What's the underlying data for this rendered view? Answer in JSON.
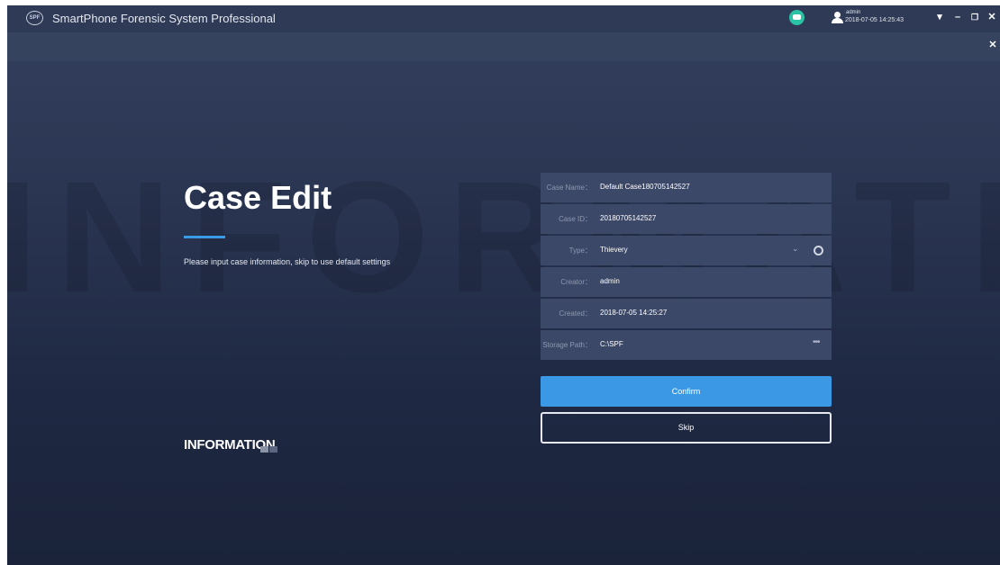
{
  "titlebar": {
    "logo_text": "SPF",
    "app_title": "SmartPhone Forensic System Professional",
    "user": {
      "name": "admin",
      "time": "2018-07-05 14:25:43"
    },
    "controls": {
      "menu": "▾",
      "minimize": "–",
      "restore": "❐",
      "close": "✕"
    }
  },
  "panel_close": "✕",
  "watermark": "INFORMATION",
  "page": {
    "title": "Case Edit",
    "description": "Please input case information, skip to use default settings",
    "info_label": "INFORMATION",
    "accent_color": "#3a9ae6"
  },
  "form": {
    "case_name": {
      "label": "Case Name：",
      "value": "Default Case180705142527"
    },
    "case_id": {
      "label": "Case ID：",
      "value": "20180705142527"
    },
    "type": {
      "label": "Type：",
      "value": "Thievery",
      "chevron": "⌄"
    },
    "creator": {
      "label": "Creator：",
      "value": "admin"
    },
    "created": {
      "label": "Created：",
      "value": "2018-07-05 14:25:27"
    },
    "storage_path": {
      "label": "Storage Path：",
      "value": "C:\\SPF",
      "more": "•••"
    }
  },
  "buttons": {
    "confirm": "Confirm",
    "skip": "Skip"
  },
  "icons": [
    "spf-logo-icon",
    "chat-icon",
    "user-icon",
    "chevron-down-icon",
    "gear-icon",
    "more-icon",
    "minimize-icon",
    "restore-icon",
    "close-icon"
  ],
  "colors": {
    "primary_button": "#3a98e4",
    "chat": "#2bc3a6",
    "field_bg": "#3b4868"
  }
}
